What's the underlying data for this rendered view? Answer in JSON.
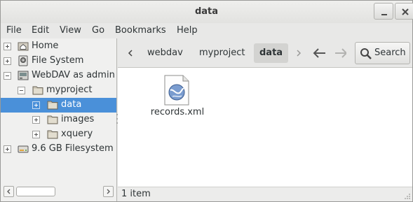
{
  "window": {
    "title": "data"
  },
  "menu": [
    "File",
    "Edit",
    "View",
    "Go",
    "Bookmarks",
    "Help"
  ],
  "sidebar": {
    "items": [
      {
        "label": "Home",
        "icon": "home-folder-icon",
        "expander": "plus"
      },
      {
        "label": "File System",
        "icon": "drive-icon",
        "expander": "plus"
      },
      {
        "label": "WebDAV as admin",
        "icon": "network-drive-icon",
        "expander": "minus"
      },
      {
        "label": "myproject",
        "icon": "folder-icon",
        "expander": "minus"
      },
      {
        "label": "data",
        "icon": "folder-icon",
        "expander": "plus",
        "selected": true
      },
      {
        "label": "images",
        "icon": "folder-icon",
        "expander": "plus"
      },
      {
        "label": "xquery",
        "icon": "folder-icon",
        "expander": "plus"
      },
      {
        "label": "9.6 GB Filesystem",
        "icon": "disk-icon",
        "expander": "plus"
      }
    ]
  },
  "pathbar": {
    "crumbs": [
      "webdav",
      "myproject",
      "data"
    ],
    "active": "data"
  },
  "toolbar": {
    "search_label": "Search"
  },
  "files": [
    {
      "name": "records.xml",
      "icon": "xml-document-icon"
    }
  ],
  "status": {
    "text": "1 item"
  },
  "colors": {
    "selection": "#4a90d9",
    "window_bg": "#e8e8e7",
    "content_bg": "#ffffff"
  }
}
